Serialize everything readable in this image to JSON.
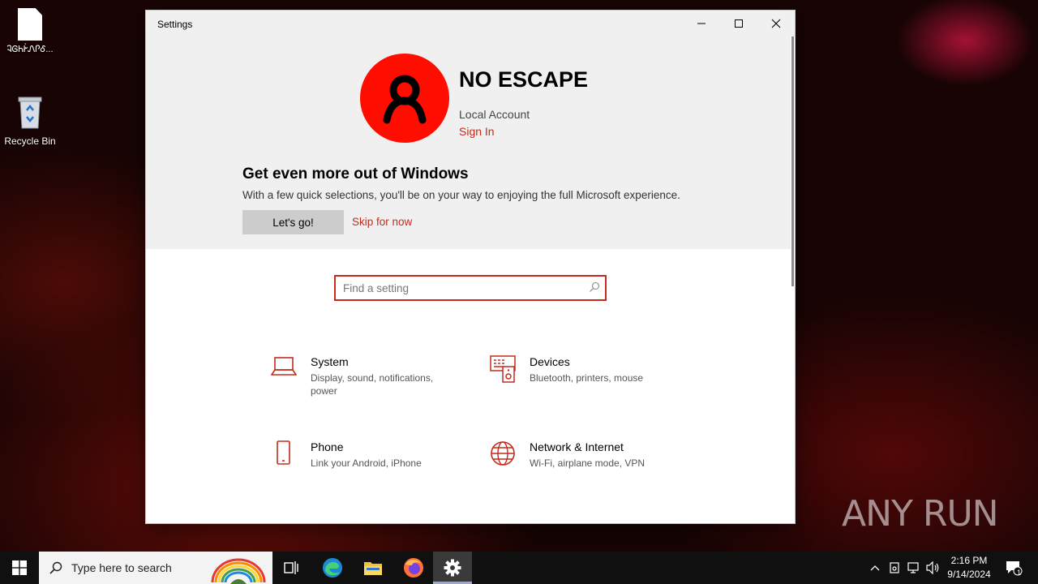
{
  "desktop": {
    "icons": [
      {
        "label": "ᎸᎶᏂᎨ̀ᏁᎵᎴ..."
      },
      {
        "label": "Recycle Bin"
      }
    ]
  },
  "window": {
    "title": "Settings",
    "controls": {
      "minimize": "minimize",
      "maximize": "maximize",
      "close": "close"
    }
  },
  "account": {
    "name": "NO ESCAPE",
    "type": "Local Account",
    "sign_in": "Sign In",
    "avatar_color": "#ff0d00"
  },
  "promo": {
    "title": "Get even more out of Windows",
    "text": "With a few quick selections, you'll be on your way to enjoying the full Microsoft experience.",
    "primary_button": "Let's go!",
    "secondary_link": "Skip for now"
  },
  "search": {
    "placeholder": "Find a setting",
    "value": ""
  },
  "categories": [
    {
      "title": "System",
      "desc": "Display, sound, notifications, power",
      "icon": "laptop-icon"
    },
    {
      "title": "Devices",
      "desc": "Bluetooth, printers, mouse",
      "icon": "devices-icon"
    },
    {
      "title": "Phone",
      "desc": "Link your Android, iPhone",
      "icon": "phone-icon"
    },
    {
      "title": "Network & Internet",
      "desc": "Wi-Fi, airplane mode, VPN",
      "icon": "globe-icon"
    }
  ],
  "taskbar": {
    "search_placeholder": "Type here to search",
    "pinned": [
      "task-view",
      "edge",
      "file-explorer",
      "firefox",
      "settings"
    ],
    "clock_time": "2:16 PM",
    "clock_date": "9/14/2024",
    "notification_count": "1"
  },
  "watermark": "ANY RUN",
  "colors": {
    "accent": "#c42b1c",
    "hero_bg": "#f0f0f0",
    "taskbar": "#101010"
  }
}
